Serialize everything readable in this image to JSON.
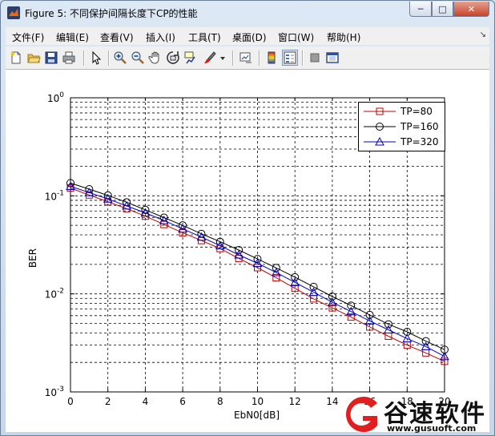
{
  "window": {
    "title": "Figure 5: 不同保护间隔长度下CP的性能",
    "controls": {
      "minimize": "─",
      "maximize": "□",
      "close": "✕"
    }
  },
  "menu": [
    "文件(F)",
    "编辑(E)",
    "查看(V)",
    "插入(I)",
    "工具(T)",
    "桌面(D)",
    "窗口(W)",
    "帮助(H)"
  ],
  "menu_dock": "↘",
  "toolbar_icons": [
    "new-figure-icon",
    "open-file-icon",
    "save-icon",
    "print-icon",
    "pointer-icon",
    "zoom-in-icon",
    "zoom-out-icon",
    "pan-hand-icon",
    "rotate-3d-icon",
    "data-cursor-icon",
    "brush-icon",
    "dropdown-arrow-icon",
    "link-plot-icon",
    "colorbar-icon",
    "legend-icon",
    "hide-plot-tools-icon",
    "show-plot-tools-icon"
  ],
  "chart_data": {
    "type": "line",
    "xlabel": "EbN0[dB]",
    "ylabel": "BER",
    "xlim": [
      0,
      20
    ],
    "ylim": [
      0.001,
      1
    ],
    "yscale": "log",
    "xticks": [
      0,
      2,
      4,
      6,
      8,
      10,
      12,
      14,
      16,
      18,
      20
    ],
    "ytick_labels": [
      {
        "base": "10",
        "exp": "0",
        "value": 1
      },
      {
        "base": "10",
        "exp": "-1",
        "value": 0.1
      },
      {
        "base": "10",
        "exp": "-2",
        "value": 0.01
      },
      {
        "base": "10",
        "exp": "-3",
        "value": 0.001
      }
    ],
    "grid": true,
    "legend_position": "top-right",
    "x": [
      0,
      1,
      2,
      3,
      4,
      5,
      6,
      7,
      8,
      9,
      10,
      11,
      12,
      13,
      14,
      15,
      16,
      17,
      18,
      19,
      20
    ],
    "series": [
      {
        "name": "TP=80",
        "color": "#c00000",
        "marker": "square",
        "values": [
          0.12,
          0.102,
          0.087,
          0.074,
          0.062,
          0.051,
          0.042,
          0.035,
          0.029,
          0.023,
          0.0185,
          0.0146,
          0.0114,
          0.0089,
          0.0072,
          0.0058,
          0.0046,
          0.0037,
          0.003,
          0.0025,
          0.00205
        ]
      },
      {
        "name": "TP=160",
        "color": "#000000",
        "marker": "circle",
        "values": [
          0.135,
          0.117,
          0.101,
          0.086,
          0.072,
          0.06,
          0.05,
          0.041,
          0.034,
          0.028,
          0.0227,
          0.0184,
          0.0148,
          0.0118,
          0.0094,
          0.0076,
          0.0061,
          0.0049,
          0.0041,
          0.0033,
          0.0027
        ]
      },
      {
        "name": "TP=320",
        "color": "#0000c0",
        "marker": "triangle",
        "values": [
          0.125,
          0.108,
          0.093,
          0.079,
          0.067,
          0.056,
          0.046,
          0.038,
          0.031,
          0.025,
          0.0205,
          0.0165,
          0.0131,
          0.0104,
          0.0082,
          0.0066,
          0.0053,
          0.0043,
          0.0035,
          0.0029,
          0.0023
        ]
      }
    ]
  },
  "watermark": {
    "text": "谷速软件",
    "url": "www.gusuoft.com",
    "brand_color": "#e02020"
  }
}
